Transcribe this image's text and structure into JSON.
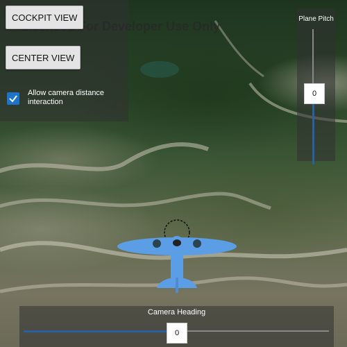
{
  "watermark": "Licensed For Developer Use Only",
  "buttons": {
    "cockpit_label": "COCKPIT VIEW",
    "center_label": "CENTER VIEW"
  },
  "checkbox": {
    "checked": true,
    "label": "Allow camera distance interaction"
  },
  "pitch": {
    "title": "Plane Pitch",
    "value": "0"
  },
  "heading": {
    "title": "Camera Heading",
    "value": "0"
  },
  "colors": {
    "accent": "#1d74c8",
    "slider_fill": "#2a5fa0",
    "plane": "#5b9ee6"
  },
  "icons": [
    "checkmark-icon",
    "airplane-icon"
  ]
}
